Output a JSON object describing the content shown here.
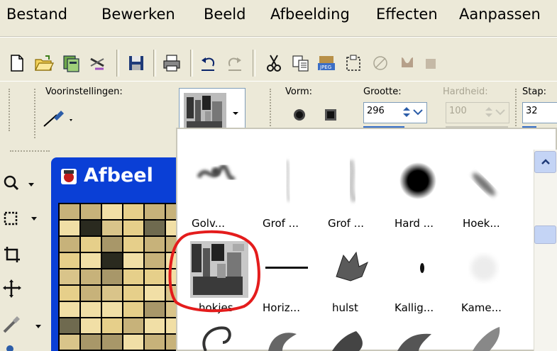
{
  "menubar": {
    "items": [
      {
        "label": "Bestand"
      },
      {
        "label": "Bewerken"
      },
      {
        "label": "Beeld"
      },
      {
        "label": "Afbeelding"
      },
      {
        "label": "Effecten"
      },
      {
        "label": "Aanpassen"
      }
    ]
  },
  "toolbar": {
    "icons": [
      "new-file-icon",
      "open-folder-icon",
      "browse-icon",
      "scan-icon",
      "save-icon",
      "print-icon",
      "undo-icon",
      "redo-icon",
      "cut-icon",
      "copy-icon",
      "paste-as-new-icon",
      "paste-selection-icon",
      "clear-icon",
      "crop-icon"
    ]
  },
  "options": {
    "presets_label": "Voorinstellingen:",
    "shape_label": "Vorm:",
    "size_label": "Grootte:",
    "size_value": "296",
    "hardness_label": "Hardheid:",
    "hardness_value": "100",
    "step_label": "Stap:",
    "step_value": "32"
  },
  "image_window": {
    "title": "Afbeel"
  },
  "brush_panel": {
    "row1": [
      "Golv...",
      "Grof ...",
      "Grof ...",
      "Hard ...",
      "Hoek..."
    ],
    "row2": [
      "hokjes",
      "Horiz...",
      "hulst",
      "Kallig...",
      "Kame..."
    ],
    "selected": "hokjes",
    "highlight_color": "#e41c1c"
  },
  "colors": {
    "titlebar_blue": "#0a3fd6",
    "panel_bg": "#ffffff",
    "chrome": "#ece9d8"
  }
}
